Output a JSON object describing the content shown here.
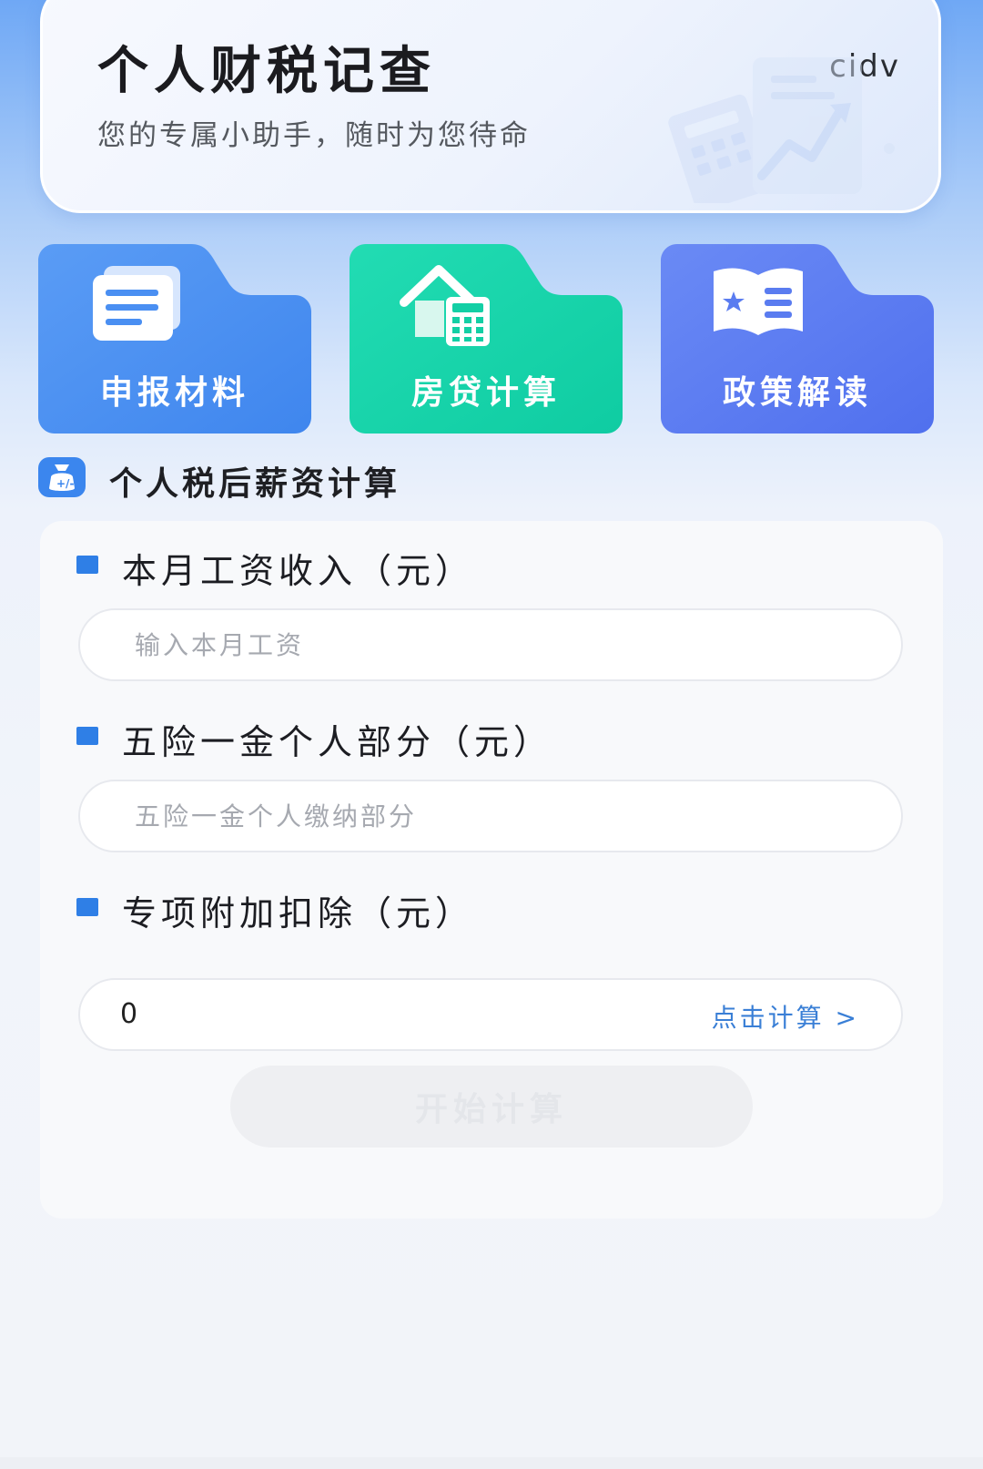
{
  "header": {
    "title": "个人财税记查",
    "subtitle": "您的专属小助手，随时为您待命",
    "corner_text": "cidv"
  },
  "quick_actions": [
    {
      "label": "申报材料",
      "icon": "document-stack-icon",
      "color": "#4a8ff2"
    },
    {
      "label": "房贷计算",
      "icon": "house-calculator-icon",
      "color": "#13d3a8"
    },
    {
      "label": "政策解读",
      "icon": "policy-book-icon",
      "color": "#5a7cf0"
    }
  ],
  "section": {
    "title": "个人税后薪资计算",
    "icon": "money-bag-icon"
  },
  "form": {
    "salary": {
      "label": "本月工资收入（元）",
      "placeholder": "输入本月工资",
      "value": ""
    },
    "insurance": {
      "label": "五险一金个人部分（元）",
      "placeholder": "五险一金个人缴纳部分",
      "value": ""
    },
    "deduction": {
      "label": "专项附加扣除（元）",
      "value": "0",
      "link_label": "点击计算 >"
    },
    "submit_label": "开始计算"
  },
  "colors": {
    "accent": "#2f7fe6",
    "link": "#3a7fd6",
    "button_disabled": "#eeeff2"
  }
}
